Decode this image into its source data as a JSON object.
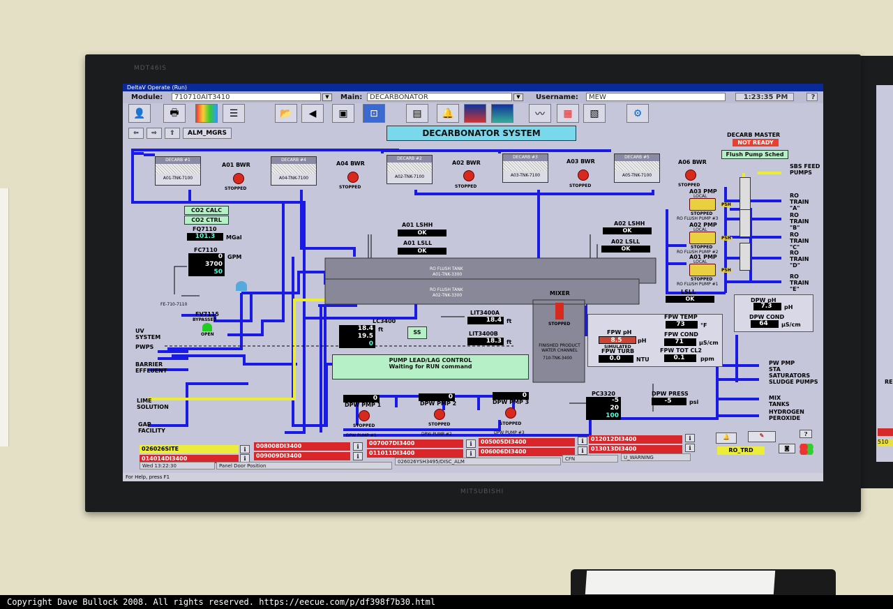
{
  "colors": {
    "pipe": "#1a1ae6",
    "alarm": "#d8262a",
    "ok": "#000000",
    "title_bg": "#7ad8ec",
    "status_green": "#b6f0c6"
  },
  "monitor": {
    "brand_top": "MDT46IS",
    "brand_bottom": "MITSUBISHI"
  },
  "window": {
    "title": "DeltaV Operate (Run)"
  },
  "header": {
    "module_label": "Module:",
    "module_value": "710710AIT3410",
    "main_label": "Main:",
    "main_value": "DECARBONATOR",
    "username_label": "Username:",
    "username_value": "MEW",
    "time": "1:23:35 PM",
    "help": "?"
  },
  "toolbar": {
    "alm_mgrs": "ALM_MGRS",
    "icons": [
      "operator-icon",
      "print-icon",
      "chart-icon",
      "list-icon",
      "folder-icon",
      "back-arrow-icon",
      "window-icon",
      "select-icon",
      "display-icon",
      "bell-icon",
      "trend-icon",
      "trend2-icon",
      "graph-icon",
      "graph2-icon",
      "graph3-icon",
      "network-icon"
    ]
  },
  "display": {
    "title": "DECARBONATOR SYSTEM"
  },
  "decarb_master": {
    "label": "DECARB MASTER",
    "status": "NOT READY",
    "sched": "Flush Pump Sched"
  },
  "tanks": [
    {
      "name": "DECARB #1",
      "id": "A01-TNK-7100",
      "bwr": "A01 BWR",
      "state": "STOPPED"
    },
    {
      "name": "DECARB #4",
      "id": "A04-TNK-7100",
      "bwr": "A04 BWR",
      "state": "STOPPED"
    },
    {
      "name": "DECARB #2",
      "id": "A02-TNK-7100",
      "bwr": "A02 BWR",
      "state": "STOPPED"
    },
    {
      "name": "DECARB #3",
      "id": "A03-TNK-7100",
      "bwr": "A03 BWR",
      "state": "STOPPED"
    },
    {
      "name": "DECARB #5",
      "id": "A05-TNK-7100",
      "bwr": "A06 BWR",
      "state": "STOPPED"
    }
  ],
  "co2": {
    "calc": "CO2 CALC",
    "ctrl": "CO2 CTRL"
  },
  "fq7110": {
    "tag": "FQ7110",
    "value": "101.3",
    "unit": "MGal"
  },
  "fc7110": {
    "tag": "FC7110",
    "v1": "0",
    "v2": "3700",
    "v3": "50",
    "unit": "GPM",
    "fe": "FE-710-7110"
  },
  "fv7115": {
    "tag": "FV7115",
    "status": "BYPASSED",
    "pos": "OPEN"
  },
  "flush_tanks": {
    "a01_lshh": "A01 LSHH",
    "a01_lsll": "A01 LSLL",
    "a02_lshh": "A02 LSHH",
    "a02_lsll": "A02 LSLL",
    "ok": "OK",
    "t1_name": "RO FLUSH TANK",
    "t1_id": "A01-TNK-3300",
    "t2_name": "RO FLUSH TANK",
    "t2_id": "A02-TNK-3300"
  },
  "mixer": {
    "label": "MIXER",
    "state": "STOPPED",
    "lsll": "LSLL",
    "lsll_ok": "OK",
    "channel": "FINISHED PRODUCT WATER CHANNEL",
    "channel_id": "710-TNK-3400"
  },
  "lc3400": {
    "tag": "LC3400",
    "v1": "18.4",
    "v2": "19.5",
    "v3": "0",
    "unit": "ft",
    "ss": "SS"
  },
  "lit": {
    "a_tag": "LIT3400A",
    "a_val": "18.4",
    "b_tag": "LIT3400B",
    "b_val": "18.3",
    "unit": "ft"
  },
  "fpw": {
    "ph_label": "FPW pH",
    "ph_val": "8.5",
    "ph_unit": "pH",
    "simulated": "SIMULATED",
    "turb_label": "FPW TURB",
    "turb_val": "0.0",
    "turb_unit": "NTU",
    "temp_label": "FPW TEMP",
    "temp_val": "73",
    "temp_unit": "°F",
    "cond_label": "FPW COND",
    "cond_val": "71",
    "cond_unit": "µS/cm",
    "cl2_label": "FPW TOT CL2",
    "cl2_val": "0.1",
    "cl2_unit": "ppm"
  },
  "dpw": {
    "ph_label": "DPW pH",
    "ph_val": "7.3",
    "ph_unit": "pH",
    "cond_label": "DPW COND",
    "cond_val": "64",
    "cond_unit": "µS/cm",
    "press_label": "DPW PRESS",
    "press_val": "-5",
    "press_unit": "psi"
  },
  "pc3320": {
    "tag": "PC3320",
    "v1": "-5",
    "v2": "20",
    "v3": "100"
  },
  "control": {
    "title": "PUMP LEAD/LAG CONTROL",
    "msg": "Waiting for RUN command"
  },
  "dpw_pumps": [
    {
      "label": "DPW PMP 1",
      "val": "0",
      "state": "STOPPED",
      "id": "DPW PUMP #1"
    },
    {
      "label": "DPW PMP 2",
      "val": "0",
      "state": "STOPPED",
      "id": "DPW PUMP #2"
    },
    {
      "label": "DPW PMP 3",
      "val": "0",
      "state": "STOPPED",
      "id": "DPW PUMP #3"
    }
  ],
  "ro_pumps": [
    {
      "label": "A03 PMP",
      "mode": "LOCAL",
      "state": "STOPPED",
      "id": "RO FLUSH PUMP #3"
    },
    {
      "label": "A02 PMP",
      "mode": "LOCAL",
      "state": "STOPPED",
      "id": "RO FLUSH PUMP #2"
    },
    {
      "label": "A01 PMP",
      "mode": "LOCAL",
      "state": "STOPPED",
      "id": "RO FLUSH PUMP #1"
    }
  ],
  "psh": "PSH",
  "left_io": {
    "uv": "UV SYSTEM",
    "pwps": "PWPS",
    "barrier": "BARRIER EFFLUENT",
    "lime": "LIME SOLUTION",
    "gap": "GAP FACILITY"
  },
  "right_io": {
    "sbs": "SBS FEED PUMPS",
    "ro_a": "RO TRAIN \"A\"",
    "ro_b": "RO TRAIN \"B\"",
    "ro_c": "RO TRAIN \"C\"",
    "ro_d": "RO TRAIN \"D\"",
    "ro_e": "RO TRAIN \"E\"",
    "pw": "PW PMP STA",
    "sat": "SATURATORS SLUDGE PUMPS",
    "mix": "MIX TANKS",
    "h2o2": "HYDROGEN PEROXIDE"
  },
  "alarms": {
    "row1": [
      "026026SITE",
      "008008DI3400",
      "007007DI3400",
      "005005DI3400",
      "012012DI3400"
    ],
    "row2": [
      "014014DI3400",
      "009009DI3400",
      "011011DI3400",
      "006006DI3400",
      "013013DI3400"
    ],
    "ro_trd": "RO_TRD"
  },
  "statusbar": {
    "date": "Wed 13:22:30",
    "panel": "Panel Door Position",
    "tag": "026026YSH3495/DISC_ALM",
    "cfn": "CFN",
    "warn": "U_WARNING",
    "help": "For Help, press F1"
  },
  "second_monitor": {
    "label": "RE",
    "code": "510"
  },
  "copyright": "Copyright Dave Bullock 2008. All rights reserved. https://eecue.com/p/df398f7b30.html"
}
